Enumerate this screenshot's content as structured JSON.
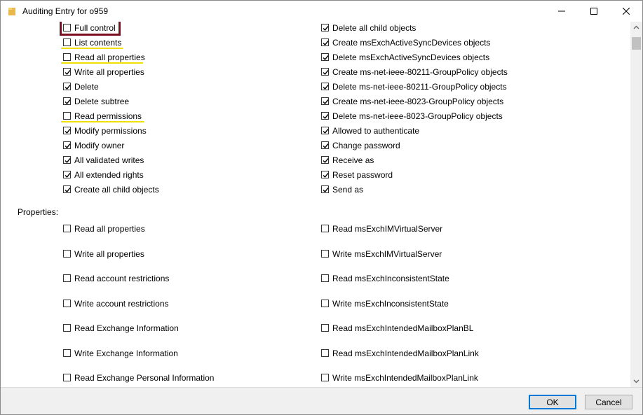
{
  "window": {
    "title": "Auditing Entry for o959"
  },
  "permissions": {
    "left": [
      {
        "label": "Full control",
        "checked": false
      },
      {
        "label": "List contents",
        "checked": false
      },
      {
        "label": "Read all properties",
        "checked": false
      },
      {
        "label": "Write all properties",
        "checked": true
      },
      {
        "label": "Delete",
        "checked": true
      },
      {
        "label": "Delete subtree",
        "checked": true
      },
      {
        "label": "Read permissions",
        "checked": false
      },
      {
        "label": "Modify permissions",
        "checked": true
      },
      {
        "label": "Modify owner",
        "checked": true
      },
      {
        "label": "All validated writes",
        "checked": true
      },
      {
        "label": "All extended rights",
        "checked": true
      },
      {
        "label": "Create all child objects",
        "checked": true
      }
    ],
    "right": [
      {
        "label": "Delete all child objects",
        "checked": true
      },
      {
        "label": "Create msExchActiveSyncDevices objects",
        "checked": true
      },
      {
        "label": "Delete msExchActiveSyncDevices objects",
        "checked": true
      },
      {
        "label": "Create ms-net-ieee-80211-GroupPolicy objects",
        "checked": true
      },
      {
        "label": "Delete ms-net-ieee-80211-GroupPolicy objects",
        "checked": true
      },
      {
        "label": "Create ms-net-ieee-8023-GroupPolicy objects",
        "checked": true
      },
      {
        "label": "Delete ms-net-ieee-8023-GroupPolicy objects",
        "checked": true
      },
      {
        "label": "Allowed to authenticate",
        "checked": true
      },
      {
        "label": "Change password",
        "checked": true
      },
      {
        "label": "Receive as",
        "checked": true
      },
      {
        "label": "Reset password",
        "checked": true
      },
      {
        "label": "Send as",
        "checked": true
      }
    ]
  },
  "properties": {
    "label": "Properties:",
    "left": [
      {
        "label": "Read all properties",
        "checked": false
      },
      {
        "label": "Write all properties",
        "checked": false
      },
      {
        "label": "Read account restrictions",
        "checked": false
      },
      {
        "label": "Write account restrictions",
        "checked": false
      },
      {
        "label": "Read Exchange Information",
        "checked": false
      },
      {
        "label": "Write Exchange Information",
        "checked": false
      },
      {
        "label": "Read Exchange Personal Information",
        "checked": false
      }
    ],
    "right": [
      {
        "label": "Read msExchIMVirtualServer",
        "checked": false
      },
      {
        "label": "Write msExchIMVirtualServer",
        "checked": false
      },
      {
        "label": "Read msExchInconsistentState",
        "checked": false
      },
      {
        "label": "Write msExchInconsistentState",
        "checked": false
      },
      {
        "label": "Read msExchIntendedMailboxPlanBL",
        "checked": false
      },
      {
        "label": "Read msExchIntendedMailboxPlanLink",
        "checked": false
      },
      {
        "label": "Write msExchIntendedMailboxPlanLink",
        "checked": false
      }
    ]
  },
  "buttons": {
    "ok": "OK",
    "cancel": "Cancel"
  },
  "colors": {
    "highlight_box": "#7b0d1e",
    "highlight_underline": "#f0e000",
    "default_button_border": "#0078d7"
  }
}
